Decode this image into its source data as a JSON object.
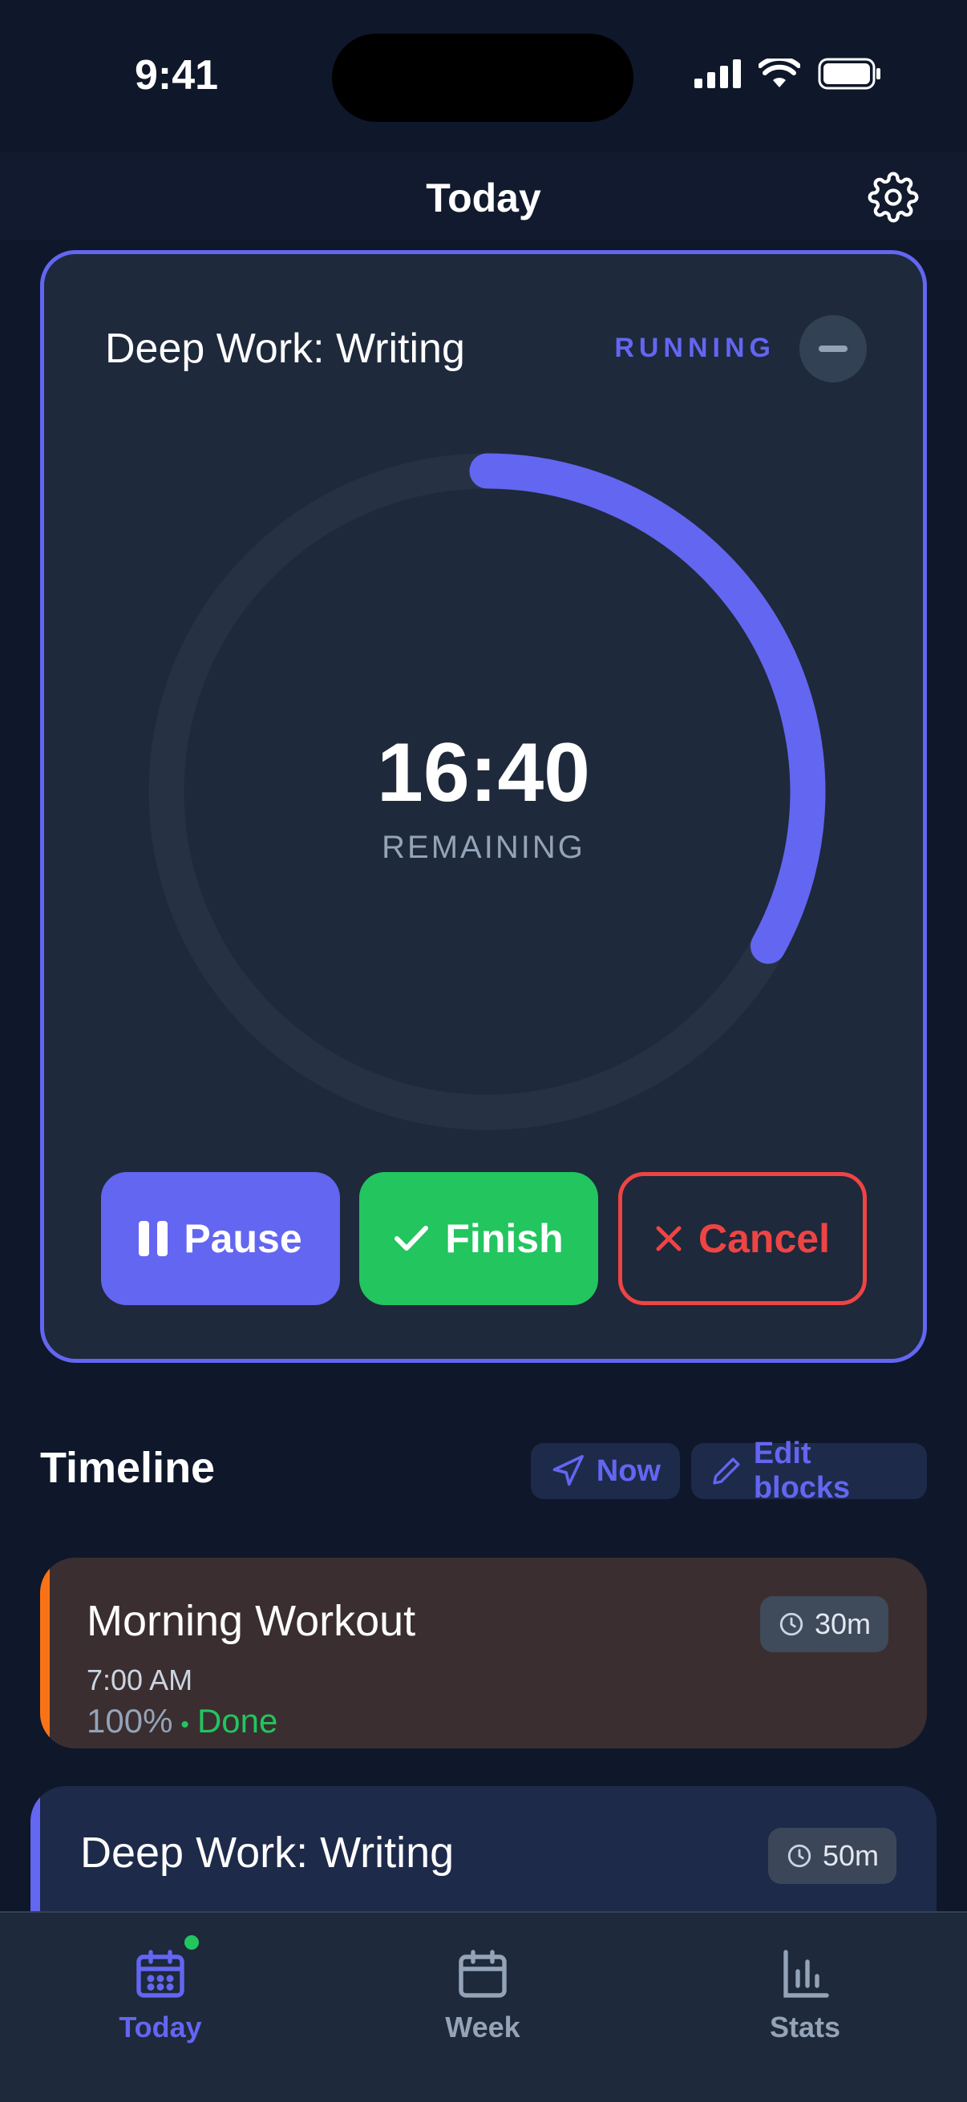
{
  "status_bar": {
    "time": "9:41"
  },
  "header": {
    "title": "Today",
    "settings_icon": "gear-icon"
  },
  "active_block": {
    "title": "Deep Work: Writing",
    "status": "RUNNING",
    "countdown": "16:40",
    "countdown_label": "REMAINING",
    "progress_fraction": 0.33,
    "buttons": {
      "pause": "Pause",
      "finish": "Finish",
      "cancel": "Cancel"
    }
  },
  "timeline": {
    "title": "Timeline",
    "now_label": "Now",
    "edit_label": "Edit blocks",
    "blocks": [
      {
        "title": "Morning Workout",
        "time": "7:00 AM",
        "progress": "100%",
        "status": "Done",
        "duration": "30m",
        "color": "#f97316"
      },
      {
        "title": "Deep Work: Writing",
        "duration": "50m",
        "color": "#6366f1"
      }
    ]
  },
  "tabs": [
    {
      "label": "Today",
      "icon": "calendar-grid-icon",
      "active": true
    },
    {
      "label": "Week",
      "icon": "calendar-icon",
      "active": false
    },
    {
      "label": "Stats",
      "icon": "bar-chart-icon",
      "active": false
    }
  ],
  "colors": {
    "accent": "#6366f1",
    "success": "#22c55e",
    "danger": "#ef4444",
    "background": "#0f172a",
    "card": "#1e293b"
  }
}
